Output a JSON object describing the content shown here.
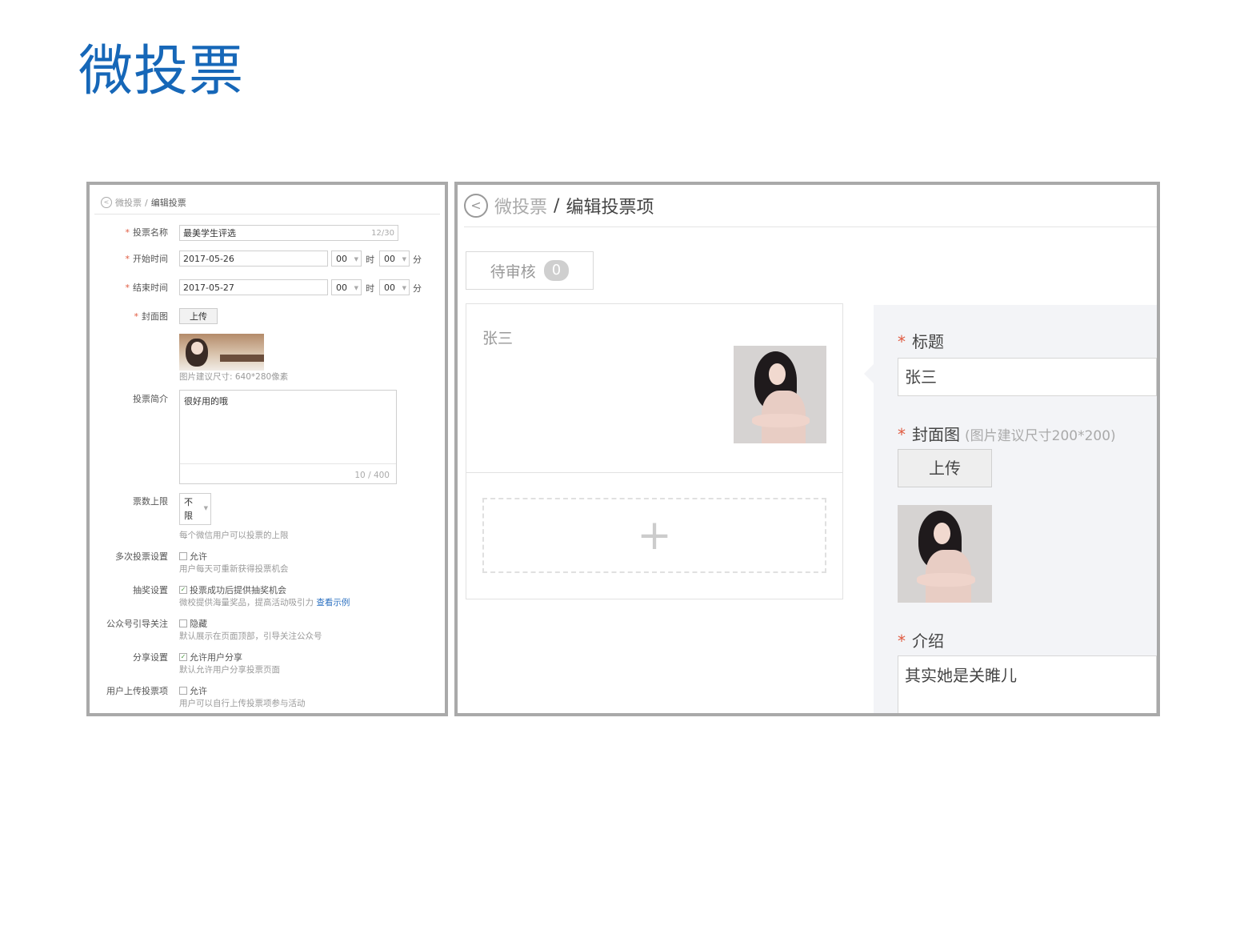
{
  "page": {
    "title": "微投票"
  },
  "left_panel": {
    "breadcrumb": {
      "back_icon": "chevron-left-circle-icon",
      "parent": "微投票",
      "separator": "/",
      "current": "编辑投票"
    },
    "vote_name": {
      "label": "投票名称",
      "value": "最美学生评选",
      "counter": "12/30"
    },
    "start_time": {
      "label": "开始时间",
      "date": "2017-05-26",
      "hour": "00",
      "hour_unit": "时",
      "minute": "00",
      "minute_unit": "分"
    },
    "end_time": {
      "label": "结束时间",
      "date": "2017-05-27",
      "hour": "00",
      "hour_unit": "时",
      "minute": "00",
      "minute_unit": "分"
    },
    "cover": {
      "label": "封面图",
      "upload_label": "上传",
      "hint": "图片建议尺寸: 640*280像素"
    },
    "intro": {
      "label": "投票简介",
      "value": "很好用的哦",
      "counter": "10 / 400"
    },
    "vote_limit": {
      "label": "票数上限",
      "value_line1": "不",
      "value_line2": "限",
      "hint": "每个微信用户可以投票的上限"
    },
    "multi_vote": {
      "label": "多次投票设置",
      "option": "允许",
      "checked": false,
      "hint": "用户每天可重新获得投票机会"
    },
    "lottery": {
      "label": "抽奖设置",
      "option": "投票成功后提供抽奖机会",
      "checked": true,
      "hint": "微校提供海量奖品，提高活动吸引力",
      "link": "查看示例"
    },
    "follow_guide": {
      "label": "公众号引导关注",
      "option": "隐藏",
      "checked": false,
      "hint": "默认展示在页面顶部，引导关注公众号"
    },
    "share": {
      "label": "分享设置",
      "option": "允许用户分享",
      "checked": true,
      "hint": "默认允许用户分享投票页面"
    },
    "user_upload": {
      "label": "用户上传投票项",
      "option": "允许",
      "checked": false,
      "hint": "用户可以自行上传投票项参与活动"
    }
  },
  "right_panel": {
    "breadcrumb": {
      "back_icon": "chevron-left-circle-icon",
      "parent": "微投票",
      "separator": "/",
      "current": "编辑投票项"
    },
    "pending_tab": {
      "label": "待审核",
      "count": "0"
    },
    "item": {
      "name": "张三"
    },
    "add_icon": "plus-icon",
    "form": {
      "title_label": "标题",
      "title_value": "张三",
      "cover_label": "封面图",
      "cover_hint": "(图片建议尺寸200*200)",
      "upload_label": "上传",
      "intro_label": "介绍",
      "intro_value": "其实她是关睢儿"
    }
  },
  "colors": {
    "title_blue": "#1667b8",
    "required_red": "#e05a40",
    "link_blue": "#2a6fc0",
    "panel_border": "#a9a9a9"
  }
}
